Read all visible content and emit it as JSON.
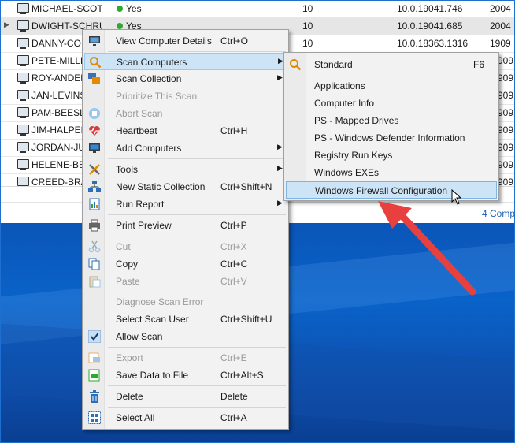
{
  "grid": {
    "rows": [
      {
        "name": "MICHAEL-SCOTT",
        "online": "Yes",
        "os": "10",
        "version": "10.0.19041.746",
        "build": "2004"
      },
      {
        "name": "DWIGHT-SCHRUT",
        "online": "Yes",
        "os": "10",
        "version": "10.0.19041.685",
        "build": "2004"
      },
      {
        "name": "DANNY-CO",
        "online": "",
        "os": "10",
        "version": "10.0.18363.1316",
        "build": "1909"
      },
      {
        "name": "PETE-MILLE",
        "online": "",
        "os": "",
        "version": "",
        "build": "909"
      },
      {
        "name": "ROY-ANDER",
        "online": "",
        "os": "",
        "version": "",
        "build": "909"
      },
      {
        "name": "JAN-LEVINS",
        "online": "",
        "os": "",
        "version": "",
        "build": "909"
      },
      {
        "name": "PAM-BEESLY",
        "online": "",
        "os": "",
        "version": "",
        "build": "909"
      },
      {
        "name": "JIM-HALPER",
        "online": "",
        "os": "",
        "version": "",
        "build": "909"
      },
      {
        "name": "JORDAN-JU",
        "online": "",
        "os": "",
        "version": "",
        "build": "909"
      },
      {
        "name": "HELENE-BEE",
        "online": "",
        "os": "",
        "version": "",
        "build": "909"
      },
      {
        "name": "CREED-BRAT",
        "online": "",
        "os": "",
        "version": "",
        "build": "909"
      }
    ]
  },
  "status": {
    "link": "4 Comp"
  },
  "menu": {
    "items": [
      {
        "label": "View Computer Details",
        "shortcut": "Ctrl+O"
      },
      {
        "label": "Scan Computers",
        "shortcut": ""
      },
      {
        "label": "Scan Collection",
        "shortcut": ""
      },
      {
        "label": "Prioritize This Scan",
        "shortcut": ""
      },
      {
        "label": "Abort Scan",
        "shortcut": ""
      },
      {
        "label": "Heartbeat",
        "shortcut": "Ctrl+H"
      },
      {
        "label": "Add Computers",
        "shortcut": ""
      },
      {
        "label": "Tools",
        "shortcut": ""
      },
      {
        "label": "New Static Collection",
        "shortcut": "Ctrl+Shift+N"
      },
      {
        "label": "Run Report",
        "shortcut": ""
      },
      {
        "label": "Print Preview",
        "shortcut": "Ctrl+P"
      },
      {
        "label": "Cut",
        "shortcut": "Ctrl+X"
      },
      {
        "label": "Copy",
        "shortcut": "Ctrl+C"
      },
      {
        "label": "Paste",
        "shortcut": "Ctrl+V"
      },
      {
        "label": "Diagnose Scan Error",
        "shortcut": ""
      },
      {
        "label": "Select Scan User",
        "shortcut": "Ctrl+Shift+U"
      },
      {
        "label": "Allow Scan",
        "shortcut": ""
      },
      {
        "label": "Export",
        "shortcut": "Ctrl+E"
      },
      {
        "label": "Save Data to File",
        "shortcut": "Ctrl+Alt+S"
      },
      {
        "label": "Delete",
        "shortcut": "Delete"
      },
      {
        "label": "Select All",
        "shortcut": "Ctrl+A"
      }
    ]
  },
  "submenu": {
    "items": [
      {
        "label": "Standard",
        "shortcut": "F6"
      },
      {
        "label": "Applications"
      },
      {
        "label": "Computer Info"
      },
      {
        "label": "PS - Mapped Drives"
      },
      {
        "label": "PS - Windows Defender Information"
      },
      {
        "label": "Registry Run Keys"
      },
      {
        "label": "Windows EXEs"
      },
      {
        "label": "Windows Firewall Configuration"
      }
    ]
  },
  "colors": {
    "accent": "#1f6fd0",
    "highlight": "#cde4f7",
    "online": "#2fa82f",
    "arrow": "#e8403f"
  }
}
